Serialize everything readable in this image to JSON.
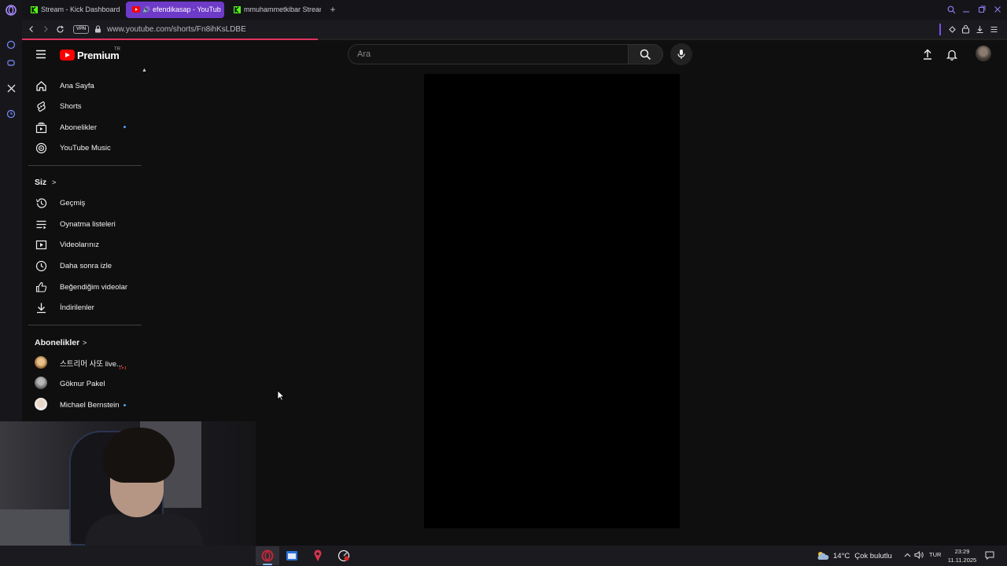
{
  "browser": {
    "tabs": [
      {
        "label": "Stream - Kick Dashboard",
        "active": false
      },
      {
        "label": "efendikasap - YouTub",
        "active": true
      },
      {
        "label": "mmuhammetkibar Stream",
        "active": false
      }
    ],
    "url": "www.youtube.com/shorts/Fn8ihKsLDBE",
    "vpn_label": "VPN",
    "accent_color": "#6e3ac8"
  },
  "yt": {
    "logo_text": "Premium",
    "logo_region": "TR",
    "search_placeholder": "Ara",
    "brand_color": "#ff0000"
  },
  "sidebar": {
    "main_items": [
      {
        "label": "Ana Sayfa",
        "icon": "home-icon"
      },
      {
        "label": "Shorts",
        "icon": "shorts-icon"
      },
      {
        "label": "Abonelikler",
        "icon": "subscriptions-icon",
        "dot": true
      },
      {
        "label": "YouTube Music",
        "icon": "music-icon"
      }
    ],
    "you_section": {
      "title": "Siz",
      "items": [
        {
          "label": "Geçmiş",
          "icon": "history-icon"
        },
        {
          "label": "Oynatma listeleri",
          "icon": "playlists-icon"
        },
        {
          "label": "Videolarınız",
          "icon": "your-videos-icon"
        },
        {
          "label": "Daha sonra izle",
          "icon": "watch-later-icon"
        },
        {
          "label": "Beğendiğim videolar",
          "icon": "liked-icon"
        },
        {
          "label": "İndirilenler",
          "icon": "downloads-icon"
        }
      ]
    },
    "subs_section": {
      "title": "Abonelikler",
      "channels": [
        {
          "label": "스트리머 사또 live...",
          "live": true
        },
        {
          "label": "Göknur Pakel",
          "dot": false
        },
        {
          "label": "Michael Bernstein",
          "dot": true
        }
      ]
    }
  },
  "taskbar": {
    "weather_temp": "14°C",
    "weather_desc": "Çok bulutlu",
    "language": "TUR",
    "time": "23:29",
    "date": "11.11.2025"
  }
}
